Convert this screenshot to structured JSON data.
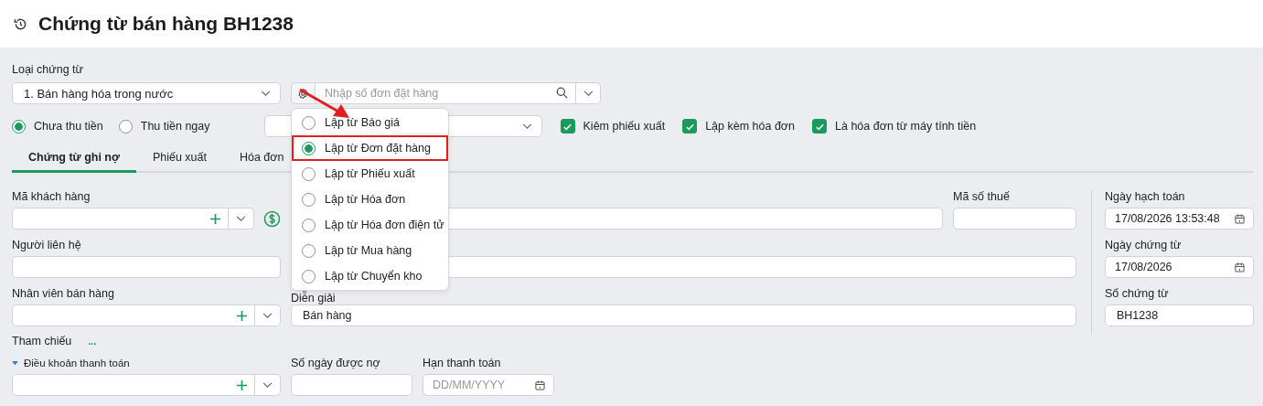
{
  "header": {
    "title": "Chứng từ bán hàng BH1238"
  },
  "document_type": {
    "label": "Loại chứng từ",
    "value": "1. Bán hàng hóa trong nước"
  },
  "order_search": {
    "placeholder": "Nhập số đơn đặt hàng"
  },
  "create_from_menu": [
    {
      "label": "Lập từ Báo giá",
      "selected": false
    },
    {
      "label": "Lập từ Đơn đặt hàng",
      "selected": true
    },
    {
      "label": "Lập từ Phiếu xuất",
      "selected": false
    },
    {
      "label": "Lập từ Hóa đơn",
      "selected": false
    },
    {
      "label": "Lập từ Hóa đơn điện tử",
      "selected": false
    },
    {
      "label": "Lập từ Mua hàng",
      "selected": false
    },
    {
      "label": "Lập từ Chuyển kho",
      "selected": false
    }
  ],
  "payment_options": [
    {
      "label": "Chưa thu tiền",
      "selected": true
    },
    {
      "label": "Thu tiền ngay",
      "selected": false
    }
  ],
  "checkboxes": [
    {
      "label": "Kiêm phiếu xuất",
      "checked": true
    },
    {
      "label": "Lập kèm hóa đơn",
      "checked": true
    },
    {
      "label": "Là hóa đơn từ máy tính tiền",
      "checked": true
    }
  ],
  "tabs": [
    {
      "label": "Chứng từ ghi nợ",
      "selected": true
    },
    {
      "label": "Phiếu xuất",
      "selected": false
    },
    {
      "label": "Hóa đơn",
      "selected": false
    }
  ],
  "customer": {
    "code_label": "Mã khách hàng",
    "tax_code_label": "Mã số thuế",
    "contact_label": "Người liên hệ",
    "salesperson_label": "Nhân viên bán hàng",
    "description_label": "Diễn giải",
    "description_value": "Bán hàng"
  },
  "voucher": {
    "posting_date_label": "Ngày hạch toán",
    "posting_date_value": "17/08/2026 13:53:48",
    "voucher_date_label": "Ngày chứng từ",
    "voucher_date_value": "17/08/2026",
    "voucher_no_label": "Số chứng từ",
    "voucher_no_value": "BH1238"
  },
  "reference": {
    "label": "Tham chiếu",
    "more": "..."
  },
  "payment_terms": {
    "label": "Điều khoản thanh toán",
    "expanded": true,
    "debt_days_label": "Số ngày được nợ",
    "due_date_label": "Hạn thanh toán",
    "due_date_placeholder": "DD/MM/YYYY"
  }
}
